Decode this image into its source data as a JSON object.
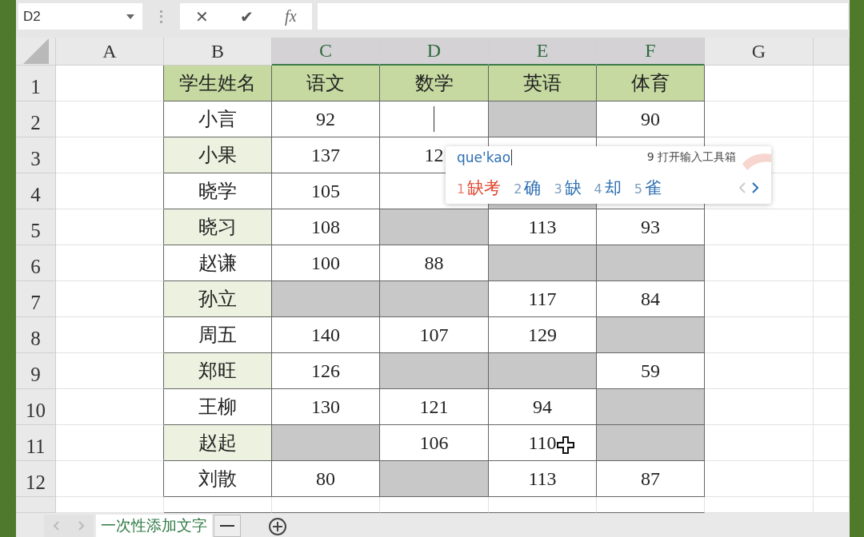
{
  "formula_bar": {
    "name_box": "D2",
    "cancel": "✕",
    "enter": "✔",
    "function": "fx"
  },
  "column_headers": [
    {
      "label": "A",
      "highlighted": false
    },
    {
      "label": "B",
      "highlighted": false
    },
    {
      "label": "C",
      "highlighted": true
    },
    {
      "label": "D",
      "highlighted": true
    },
    {
      "label": "E",
      "highlighted": true
    },
    {
      "label": "F",
      "highlighted": true
    },
    {
      "label": "G",
      "highlighted": false
    }
  ],
  "rows": [
    {
      "number": "1",
      "kind": "header",
      "cells": [
        {
          "text": "学生姓名",
          "active": false
        },
        {
          "text": "语文",
          "active": false
        },
        {
          "text": "数学",
          "active": false
        },
        {
          "text": "英语",
          "active": false
        },
        {
          "text": "体育",
          "active": false
        }
      ]
    },
    {
      "number": "2",
      "kind": "data",
      "tinted": false,
      "cells": [
        {
          "text": "小言",
          "shaded": false,
          "active": false
        },
        {
          "text": "92",
          "shaded": false,
          "active": false
        },
        {
          "shaded": false,
          "active": true
        },
        {
          "shaded": true,
          "active": false
        },
        {
          "text": "90",
          "shaded": false,
          "active": false
        }
      ]
    },
    {
      "number": "3",
      "kind": "data",
      "tinted": true,
      "cells": [
        {
          "text": "小果",
          "shaded": false,
          "active": false
        },
        {
          "text": "137",
          "shaded": false,
          "active": false
        },
        {
          "text": "12",
          "shaded": false,
          "active": false
        },
        {
          "shaded": false,
          "active": false
        },
        {
          "shaded": false,
          "active": false
        }
      ]
    },
    {
      "number": "4",
      "kind": "data",
      "tinted": false,
      "cells": [
        {
          "text": "晓学",
          "shaded": false,
          "active": false
        },
        {
          "text": "105",
          "shaded": false,
          "active": false
        },
        {
          "shaded": false,
          "active": false
        },
        {
          "shaded": true,
          "active": false
        },
        {
          "shaded": false
        }
      ]
    },
    {
      "number": "5",
      "kind": "data",
      "tinted": true,
      "cells": [
        {
          "text": "晓习",
          "shaded": false,
          "active": false
        },
        {
          "text": "108",
          "shaded": false,
          "active": false
        },
        {
          "shaded": true,
          "active": false
        },
        {
          "text": "113",
          "shaded": false,
          "active": false
        },
        {
          "text": "93",
          "shaded": false,
          "active": false
        }
      ]
    },
    {
      "number": "6",
      "kind": "data",
      "tinted": false,
      "cells": [
        {
          "text": "赵谦",
          "shaded": false,
          "active": false
        },
        {
          "text": "100",
          "shaded": false,
          "active": false
        },
        {
          "text": "88",
          "shaded": false,
          "active": false
        },
        {
          "shaded": true,
          "active": false
        },
        {
          "shaded": true,
          "active": false
        }
      ]
    },
    {
      "number": "7",
      "kind": "data",
      "tinted": true,
      "cells": [
        {
          "text": "孙立",
          "shaded": false,
          "active": false
        },
        {
          "shaded": true,
          "active": false
        },
        {
          "shaded": true,
          "active": false
        },
        {
          "text": "117",
          "shaded": false,
          "active": false
        },
        {
          "text": "84",
          "shaded": false,
          "active": false
        }
      ]
    },
    {
      "number": "8",
      "kind": "data",
      "tinted": false,
      "cells": [
        {
          "text": "周五",
          "shaded": false,
          "active": false
        },
        {
          "text": "140",
          "shaded": false,
          "active": false
        },
        {
          "text": "107",
          "shaded": false,
          "active": false
        },
        {
          "text": "129",
          "shaded": false,
          "active": false
        },
        {
          "shaded": true,
          "active": false
        }
      ]
    },
    {
      "number": "9",
      "kind": "data",
      "tinted": true,
      "cells": [
        {
          "text": "郑旺",
          "shaded": false,
          "active": false
        },
        {
          "text": "126",
          "shaded": false,
          "active": false
        },
        {
          "shaded": true,
          "active": false
        },
        {
          "shaded": true,
          "active": false
        },
        {
          "text": "59",
          "shaded": false,
          "active": false
        }
      ]
    },
    {
      "number": "10",
      "kind": "data",
      "tinted": false,
      "cells": [
        {
          "text": "王柳",
          "shaded": false,
          "active": false
        },
        {
          "text": "130",
          "shaded": false,
          "active": false
        },
        {
          "text": "121",
          "shaded": false,
          "active": false
        },
        {
          "text": "94",
          "shaded": false,
          "active": false
        },
        {
          "shaded": true,
          "active": false
        }
      ]
    },
    {
      "number": "11",
      "kind": "data",
      "tinted": true,
      "cells": [
        {
          "text": "赵起",
          "shaded": false,
          "active": false
        },
        {
          "shaded": true,
          "active": false
        },
        {
          "text": "106",
          "shaded": false,
          "active": false
        },
        {
          "text": "110",
          "shaded": false,
          "active": false
        },
        {
          "shaded": true,
          "active": false
        }
      ]
    },
    {
      "number": "12",
      "kind": "data",
      "tinted": false,
      "cells": [
        {
          "text": "刘散",
          "shaded": false,
          "active": false
        },
        {
          "text": "80",
          "shaded": false,
          "active": false
        },
        {
          "shaded": true,
          "active": false
        },
        {
          "text": "113",
          "shaded": false,
          "active": false
        },
        {
          "text": "87",
          "shaded": false,
          "active": false
        }
      ]
    }
  ],
  "ime": {
    "input": "que'kao",
    "toolbox": "9 打开输入工具箱",
    "candidates": [
      {
        "number": "1",
        "text": "缺考",
        "selected": true
      },
      {
        "number": "2",
        "text": "确",
        "selected": false
      },
      {
        "number": "3",
        "text": "缺",
        "selected": false
      },
      {
        "number": "4",
        "text": "却",
        "selected": false
      },
      {
        "number": "5",
        "text": "雀",
        "selected": false
      }
    ]
  },
  "sheet_tabs": [
    {
      "label": "一次性添加文字",
      "selected": true
    }
  ]
}
